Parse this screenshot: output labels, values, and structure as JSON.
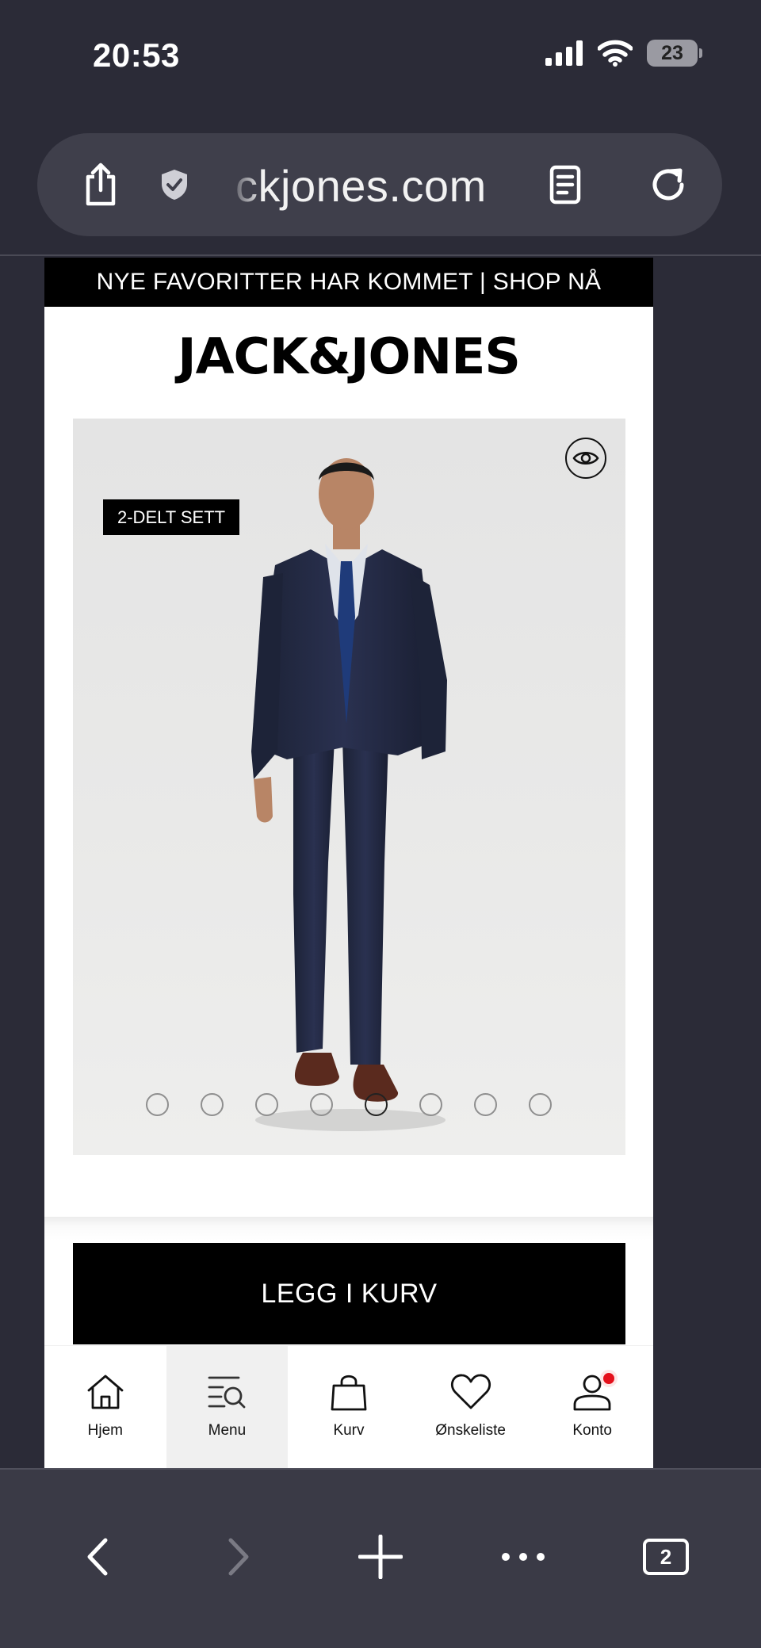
{
  "status_bar": {
    "time": "20:53",
    "battery": "23"
  },
  "browser": {
    "url": "ckjones.com",
    "tabs_count": "2"
  },
  "page": {
    "promo_banner": "NYE FAVORITTER HAR KOMMET | SHOP NÅ",
    "brand_logo": "JACK&JONES",
    "product": {
      "badge": "2-DELT SETT",
      "image_count": 8,
      "active_image": 5
    },
    "add_to_cart_label": "LEGG I KURV",
    "bottom_nav": [
      {
        "label": "Hjem",
        "icon": "home-icon"
      },
      {
        "label": "Menu",
        "icon": "menu-search-icon"
      },
      {
        "label": "Kurv",
        "icon": "bag-icon"
      },
      {
        "label": "Ønskeliste",
        "icon": "heart-icon"
      },
      {
        "label": "Konto",
        "icon": "account-icon"
      }
    ]
  },
  "colors": {
    "chrome_background": "#2b2b37",
    "url_pill": "#3f3f4b",
    "notification": "#e4101b"
  }
}
